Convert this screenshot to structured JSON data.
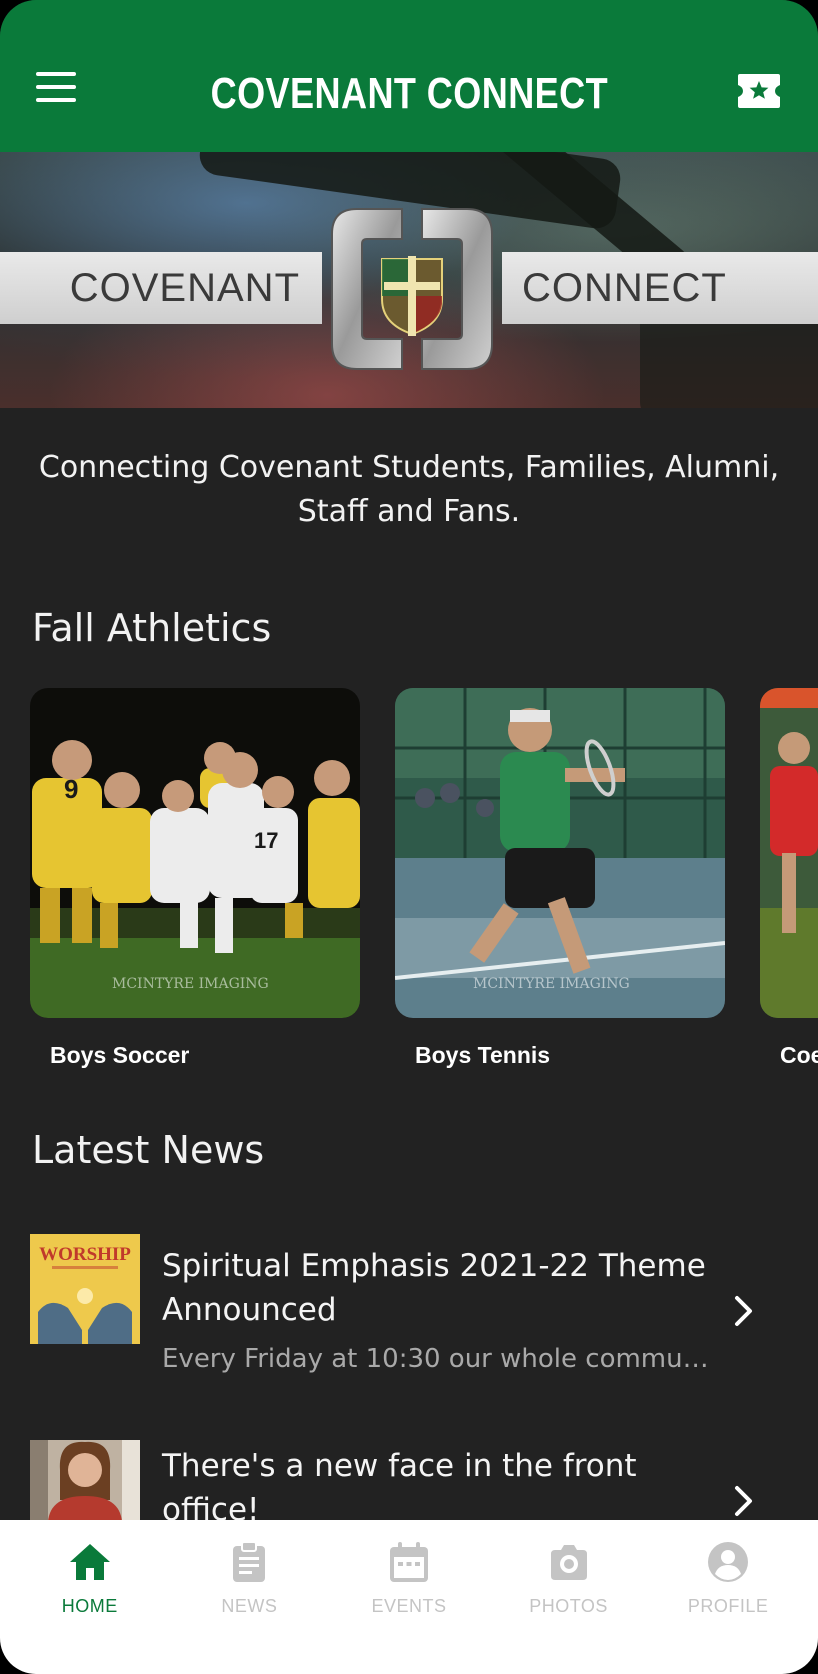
{
  "header": {
    "title": "COVENANT CONNECT",
    "menu_icon": "hamburger-menu-icon",
    "ticket_icon": "ticket-star-icon"
  },
  "hero": {
    "left_word": "COVENANT",
    "right_word": "CONNECT"
  },
  "tagline": "Connecting Covenant Students, Families, Alumni, Staff and Fans.",
  "athletics": {
    "title": "Fall Athletics",
    "items": [
      {
        "label": "Boys Soccer"
      },
      {
        "label": "Boys Tennis"
      },
      {
        "label": "Coe"
      }
    ]
  },
  "news": {
    "title": "Latest News",
    "items": [
      {
        "title": "Spiritual Emphasis 2021-22 Theme Announced",
        "subtitle": "Every Friday at 10:30 our whole commun…",
        "thumb_text": "WORSHIP"
      },
      {
        "title": "There's a new face in the front office!",
        "subtitle": ""
      }
    ]
  },
  "bottom_nav": {
    "items": [
      {
        "label": "HOME",
        "icon": "home-icon",
        "active": true
      },
      {
        "label": "NEWS",
        "icon": "clipboard-icon",
        "active": false
      },
      {
        "label": "EVENTS",
        "icon": "calendar-icon",
        "active": false
      },
      {
        "label": "PHOTOS",
        "icon": "camera-icon",
        "active": false
      },
      {
        "label": "PROFILE",
        "icon": "profile-icon",
        "active": false
      }
    ]
  },
  "colors": {
    "brand_green": "#0a7a3a",
    "background": "#222222",
    "nav_inactive": "#c4c4c4"
  }
}
